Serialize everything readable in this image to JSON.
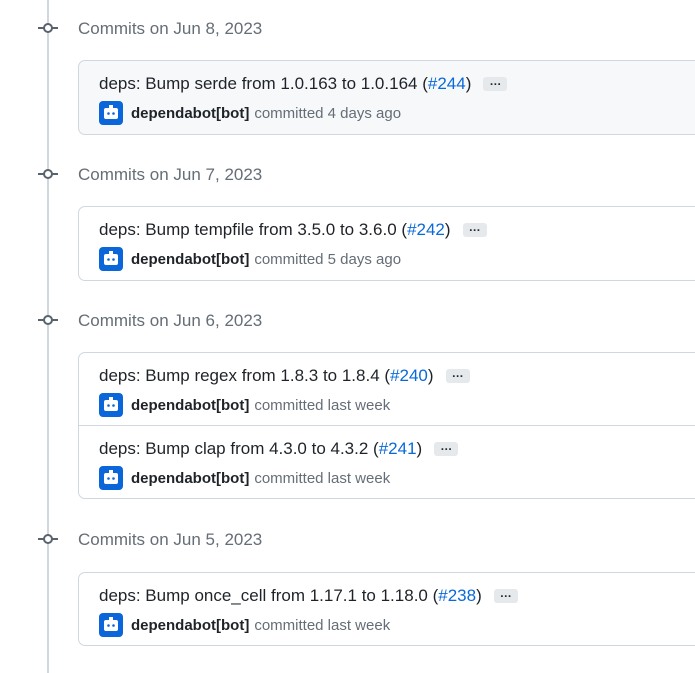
{
  "groups": [
    {
      "date": "Commits on Jun 8, 2023",
      "highlight": true,
      "commits": [
        {
          "title": "deps: Bump serde from 1.0.163 to 1.0.164",
          "pr": "#244",
          "author": "dependabot[bot]",
          "when": "committed 4 days ago",
          "more": "…"
        }
      ]
    },
    {
      "date": "Commits on Jun 7, 2023",
      "highlight": false,
      "commits": [
        {
          "title": "deps: Bump tempfile from 3.5.0 to 3.6.0",
          "pr": "#242",
          "author": "dependabot[bot]",
          "when": "committed 5 days ago",
          "more": "…"
        }
      ]
    },
    {
      "date": "Commits on Jun 6, 2023",
      "highlight": false,
      "commits": [
        {
          "title": "deps: Bump regex from 1.8.3 to 1.8.4",
          "pr": "#240",
          "author": "dependabot[bot]",
          "when": "committed last week",
          "more": "…"
        },
        {
          "title": "deps: Bump clap from 4.3.0 to 4.3.2",
          "pr": "#241",
          "author": "dependabot[bot]",
          "when": "committed last week",
          "more": "…"
        }
      ]
    },
    {
      "date": "Commits on Jun 5, 2023",
      "highlight": false,
      "commits": [
        {
          "title": "deps: Bump once_cell from 1.17.1 to 1.18.0",
          "pr": "#238",
          "author": "dependabot[bot]",
          "when": "committed last week",
          "more": "…"
        }
      ]
    }
  ],
  "colors": {
    "link": "#0969da",
    "avatar": "#0a66d9",
    "border": "#d0d7de",
    "muted": "#656d76"
  },
  "icons": {
    "timeline": "git-commit-icon",
    "avatar": "dependabot-icon"
  }
}
